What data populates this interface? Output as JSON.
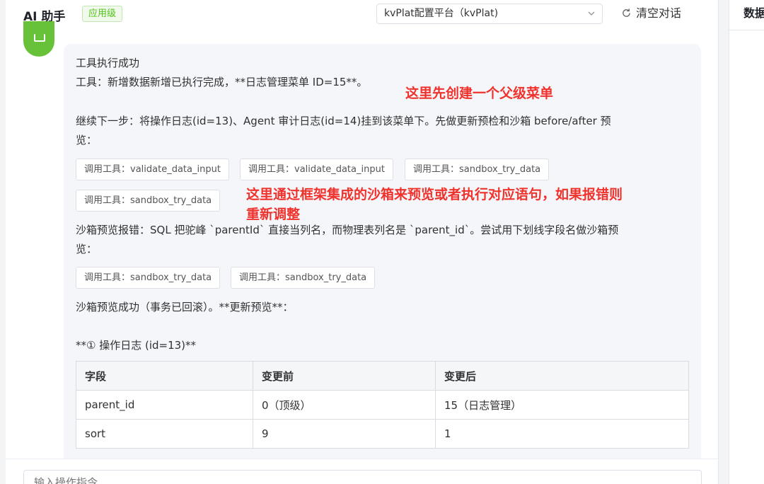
{
  "header": {
    "title": "AI 助手",
    "badge": "应用级",
    "platform_select": "kvPlat配置平台（kvPlat)",
    "clear_label": "清空对话"
  },
  "message": {
    "line1": "工具执行成功",
    "line2": "工具：新增数据新增已执行完成，**日志管理菜单 ID=15**。",
    "line3a": "继续下一步：将操作日志(id=13)、Agent 审计日志(id=14)挂到该菜单下。先做更新预检和沙箱 before/after 预",
    "line3b": "览：",
    "tool_calls_1": [
      "调用工具：validate_data_input",
      "调用工具：validate_data_input",
      "调用工具：sandbox_try_data",
      "调用工具：sandbox_try_data"
    ],
    "line4a": "沙箱预览报错：SQL 把驼峰 `parentId` 直接当列名，而物理表列名是 `parent_id`。尝试用下划线字段名做沙箱预",
    "line4b": "览：",
    "tool_calls_2": [
      "调用工具：sandbox_try_data",
      "调用工具：sandbox_try_data"
    ],
    "line5": "沙箱预览成功（事务已回滚）。**更新预览**：",
    "line6": "**① 操作日志 (id=13)**",
    "table": {
      "headers": [
        "字段",
        "变更前",
        "变更后"
      ],
      "rows": [
        [
          "parent_id",
          "0（顶级）",
          "15（日志管理）"
        ],
        [
          "sort",
          "9",
          "1"
        ]
      ]
    }
  },
  "annotations": {
    "note1": "这里先创建一个父级菜单",
    "note2a": "这里通过框架集成的沙箱来预览或者执行对应语句，如果报错则",
    "note2b": "重新调整"
  },
  "input": {
    "placeholder": "输入操作指令"
  },
  "right_panel": {
    "title": "数据"
  },
  "colors": {
    "accent_green": "#67c23a",
    "annotation_red": "#f0322d"
  }
}
